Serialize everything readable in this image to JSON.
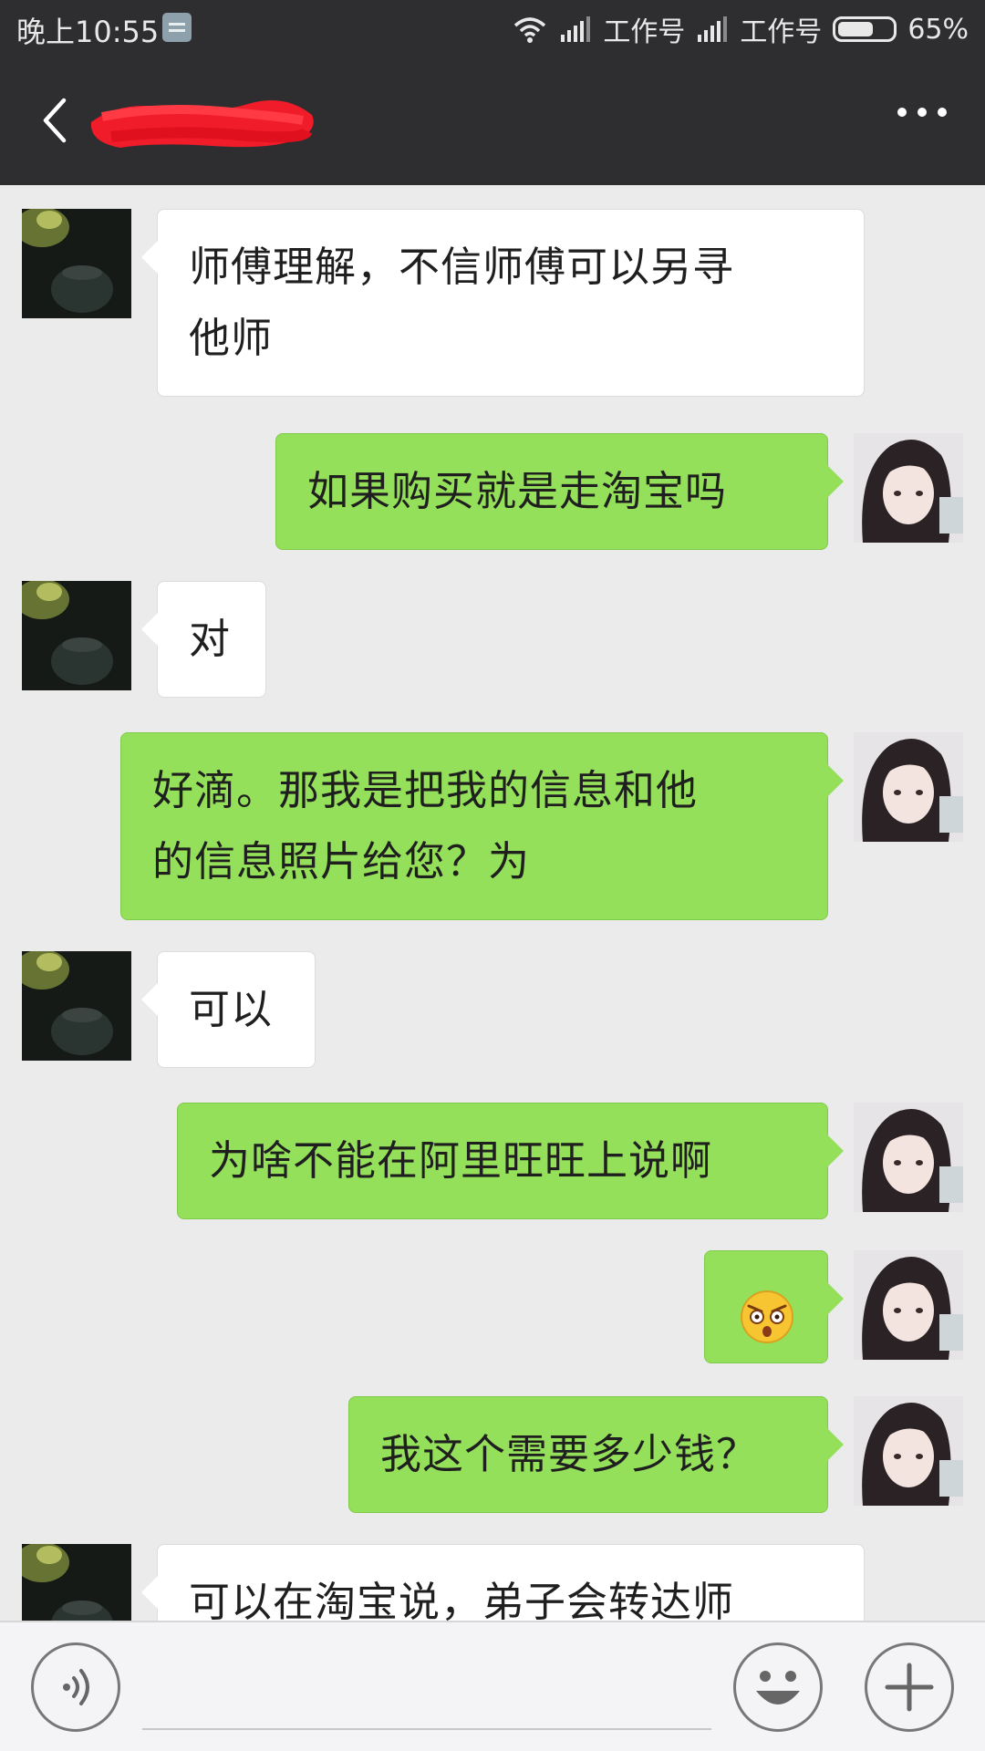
{
  "status_bar": {
    "time": "晚上10:55",
    "carrier1": "工作号",
    "carrier2": "工作号",
    "battery": "65%",
    "battery_level": 0.65
  },
  "header": {
    "back_icon": "chevron-left-icon",
    "contact_name_redacted": true,
    "more_icon": "more-dots-icon"
  },
  "messages": [
    {
      "side": "in",
      "text_lines": [
        "师傅理解，不信师傅可以另寻",
        "他师"
      ]
    },
    {
      "side": "out",
      "text_lines": [
        "如果购买就是走淘宝吗"
      ]
    },
    {
      "side": "in",
      "text_lines": [
        "对"
      ]
    },
    {
      "side": "out",
      "text_lines": [
        "好滴。那我是把我的信息和他",
        "的信息照片给您？为"
      ]
    },
    {
      "side": "in",
      "text_lines": [
        "可以"
      ]
    },
    {
      "side": "out",
      "text_lines": [
        "为啥不能在阿里旺旺上说啊"
      ]
    },
    {
      "side": "out",
      "emoji": "shocked-face-emoji"
    },
    {
      "side": "out",
      "text_lines": [
        "我这个需要多少钱？"
      ]
    },
    {
      "side": "in",
      "text_lines": [
        "可以在淘宝说，弟子会转达师"
      ]
    }
  ],
  "input_bar": {
    "voice_icon": "voice-icon",
    "emoji_icon": "smile-icon",
    "add_icon": "plus-icon"
  },
  "colors": {
    "header_bg": "#2e2e30",
    "chat_bg": "#ebebeb",
    "outgoing_bubble": "#95e05a",
    "incoming_bubble": "#ffffff"
  }
}
